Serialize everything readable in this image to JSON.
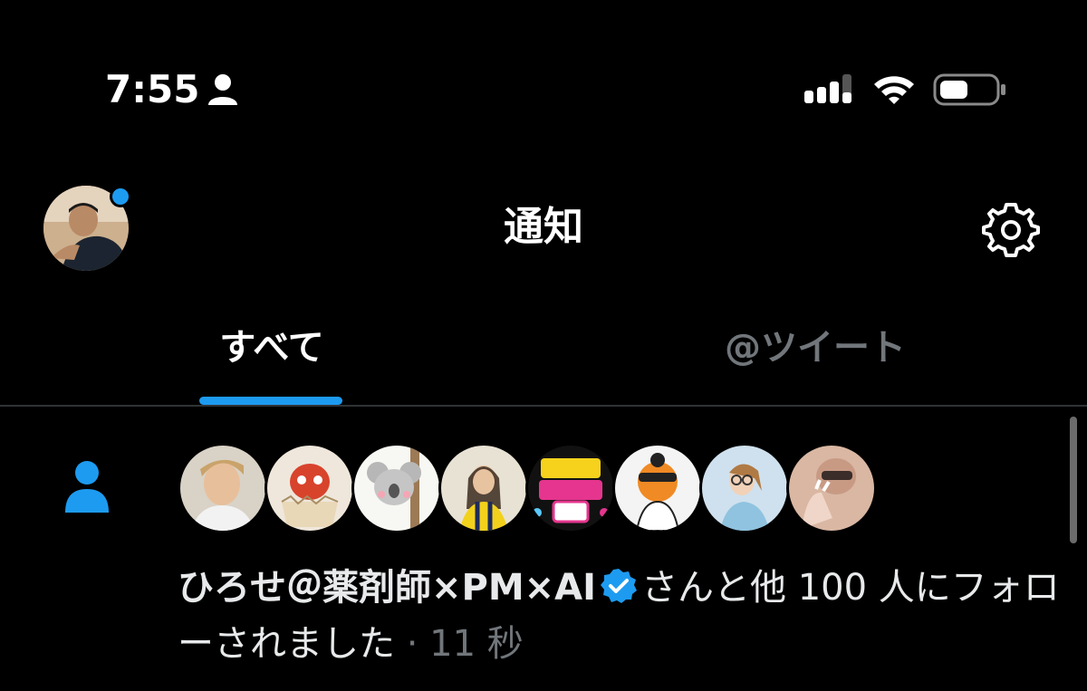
{
  "status_bar": {
    "time": "7:55",
    "icons": [
      "person-icon",
      "cellular-signal-icon",
      "wifi-icon",
      "battery-icon"
    ]
  },
  "header": {
    "title": "通知",
    "avatar": "profile-avatar",
    "has_unread": true,
    "settings_icon": "gear-icon"
  },
  "tabs": [
    {
      "label": "すべて",
      "active": true
    },
    {
      "label": "@ツイート",
      "active": false
    }
  ],
  "notification": {
    "icon": "person-follow-icon",
    "avatars": [
      "avatar-smiling-person",
      "avatar-red-dragon",
      "avatar-koala",
      "avatar-anime-girl-soccer",
      "avatar-buzz-love-tv",
      "avatar-tiger-mascot",
      "avatar-woman-glasses",
      "avatar-hand-nails"
    ],
    "name": "ひろせ＠薬剤師×PM×AI",
    "verified": true,
    "text": "さんと他 100 人にフォローされました",
    "separator": " · ",
    "time": "11 秒"
  },
  "colors": {
    "accent": "#1d9bf0",
    "background": "#000000",
    "muted": "#71767b"
  }
}
